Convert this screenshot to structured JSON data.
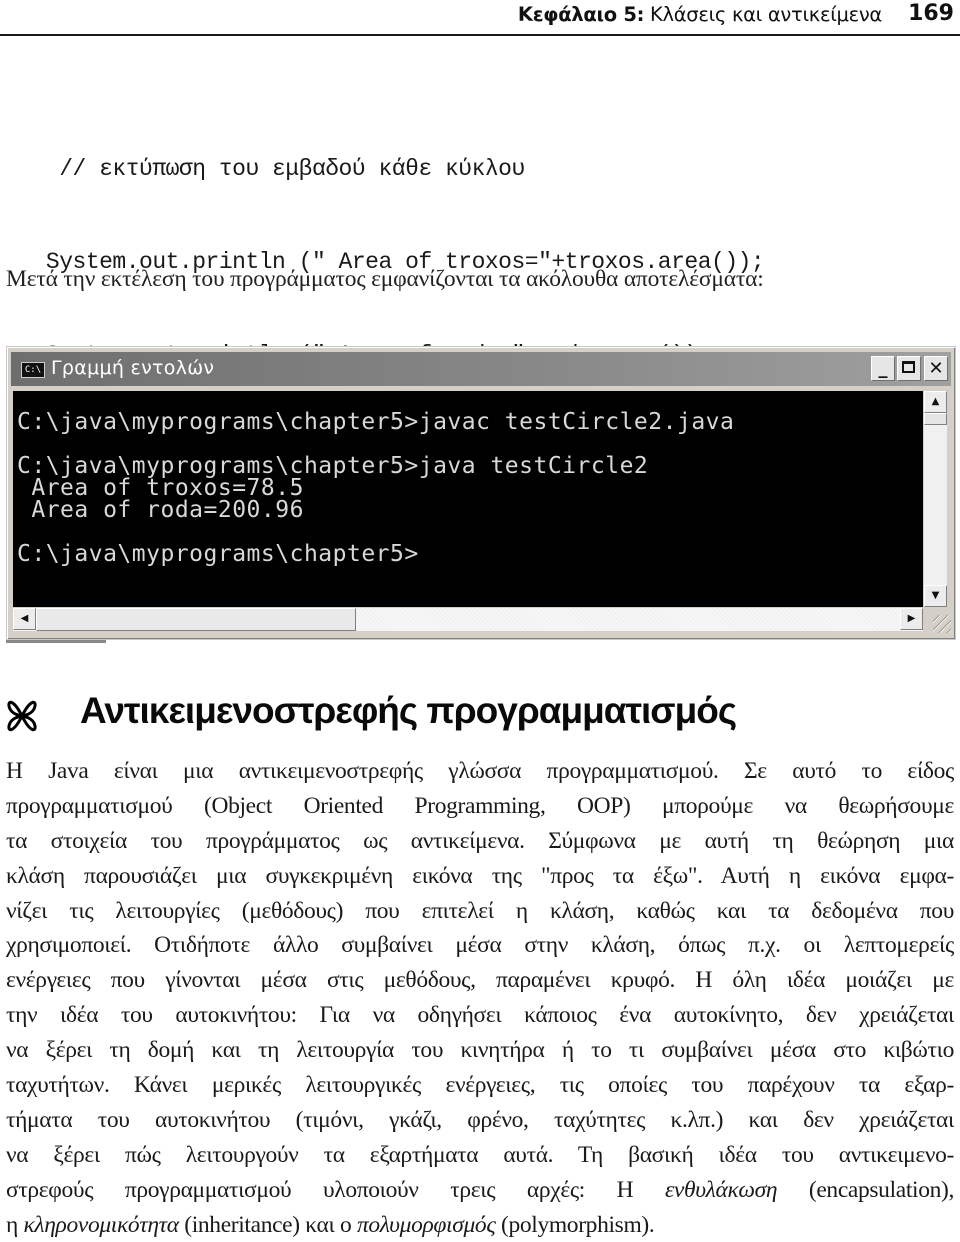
{
  "header": {
    "chapter_label": "Κεφάλαιο 5:",
    "chapter_title": "Κλάσεις και αντικείμενα",
    "page_number": "169"
  },
  "code_listing": {
    "lines": [
      "    // εκτύπωση του εμβαδού κάθε κύκλου",
      "   System.out.println (\" Area of troxos=\"+troxos.area());",
      "   System.out.println (\" Area of roda=\"+roda.area());",
      "  }",
      "}"
    ]
  },
  "lead_sentence": "Μετά την εκτέλεση του προγράμματος εμφανίζονται τα ακόλουθα αποτελέσματα:",
  "console_window": {
    "title": "Γραμμή εντολών",
    "sys_icon_label": "C:\\",
    "buttons": {
      "minimize": "_",
      "close": "✕"
    },
    "output_lines": [
      "C:\\java\\myprograms\\chapter5>javac testCircle2.java",
      "",
      "C:\\java\\myprograms\\chapter5>java testCircle2",
      " Area of troxos=78.5",
      " Area of roda=200.96",
      "",
      "C:\\java\\myprograms\\chapter5>"
    ],
    "scroll": {
      "up": "▲",
      "down": "▼",
      "left": "◀",
      "right": "▶"
    }
  },
  "section": {
    "icon": "butterfly-bullet-icon",
    "title": "Αντικειμενοστρεφής προγραμματισμός"
  },
  "paragraph": {
    "lines": [
      "Η Java είναι μια αντικειμενοστρεφής γλώσσα προγραμματισμού. Σε αυτό το είδος",
      "προγραμματισμού (Object Oriented Programming, OOP) μπορούμε να θεωρήσουμε",
      "τα στοιχεία του προγράμματος ως αντικείμενα. Σύμφωνα με αυτή τη θεώρηση μια",
      "κλάση παρουσιάζει μια συγκεκριμένη εικόνα της \"προς τα έξω\". Αυτή η εικόνα εμφα-",
      "νίζει τις λειτουργίες (μεθόδους) που επιτελεί η κλάση, καθώς και τα δεδομένα που",
      "χρησιμοποιεί. Οτιδήποτε άλλο συμβαίνει μέσα στην κλάση, όπως π.χ. οι λεπτομερείς",
      "ενέργειες που γίνονται μέσα στις μεθόδους, παραμένει κρυφό. Η όλη ιδέα μοιάζει με",
      "την ιδέα του αυτοκινήτου: Για να οδηγήσει κάποιος ένα αυτοκίνητο, δεν χρειάζεται",
      "να ξέρει τη δομή και τη λειτουργία του κινητήρα ή το τι συμβαίνει μέσα στο κιβώτιο",
      "ταχυτήτων. Κάνει μερικές λειτουργικές ενέργειες, τις οποίες του παρέχουν τα εξαρ-",
      "τήματα του αυτοκινήτου (τιμόνι, γκάζι, φρένο, ταχύτητες κ.λπ.) και δεν χρειάζεται",
      "να ξέρει πώς λειτουργούν τα εξαρτήματα αυτά. Τη βασική ιδέα του αντικειμενο-"
    ],
    "line13": {
      "pre": "στρεφούς προγραμματισμού υλοποιούν τρεις αρχές: Η ",
      "term1": "ενθυλάκωση",
      "post": " (encapsulation),"
    },
    "line14": {
      "pre": "η ",
      "term2": "κληρονομικότητα",
      "mid": " (inheritance) και ο ",
      "term3": "πολυμορφισμός",
      "post": " (polymorphism)."
    }
  }
}
